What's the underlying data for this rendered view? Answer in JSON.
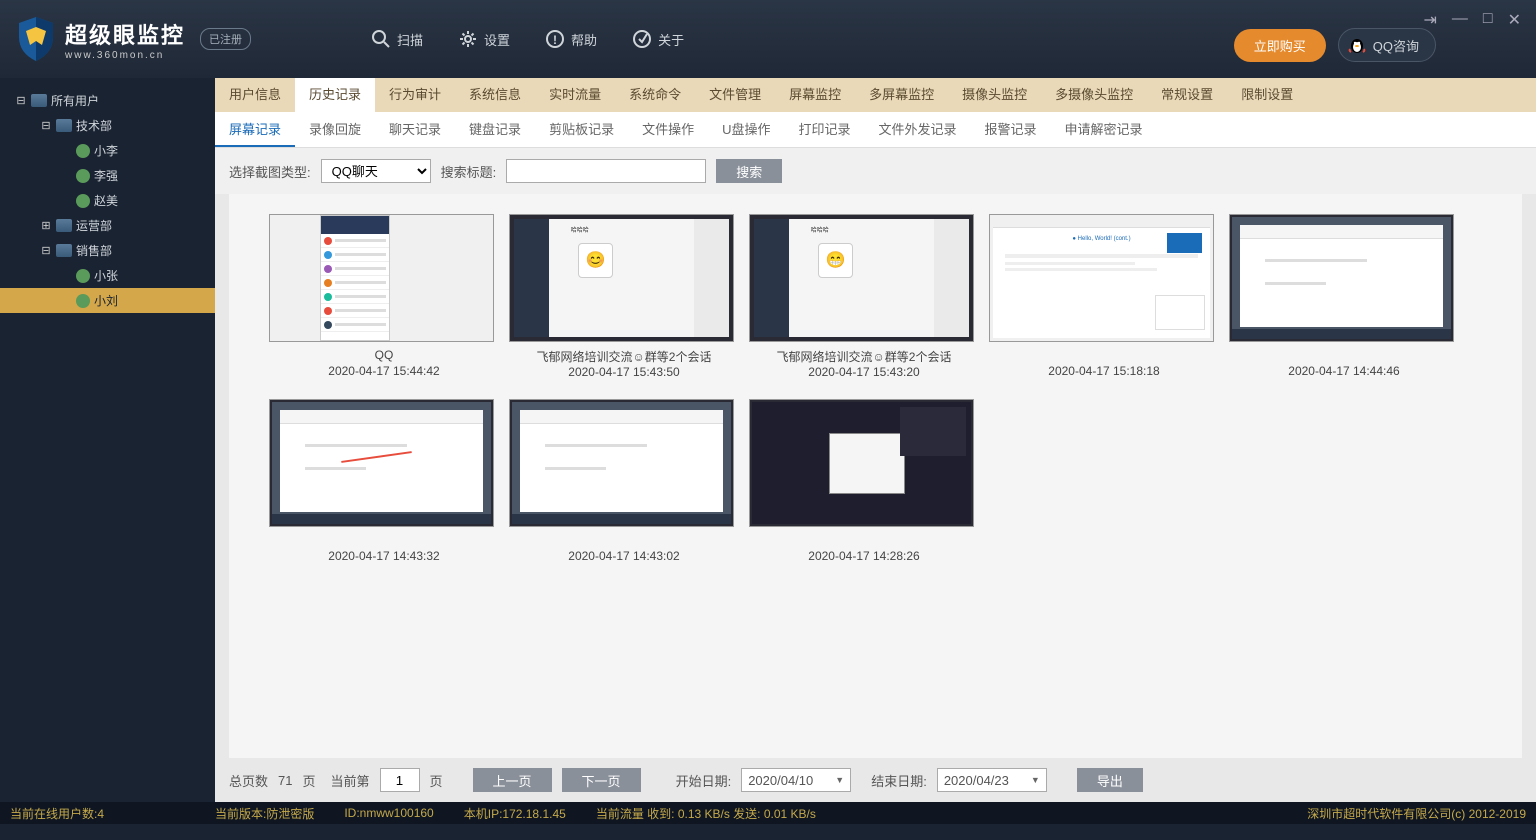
{
  "app": {
    "title_cn": "超级眼监控",
    "title_en": "www.360mon.cn",
    "registered": "已注册"
  },
  "top_actions": {
    "scan": "扫描",
    "settings": "设置",
    "help": "帮助",
    "about": "关于"
  },
  "buttons": {
    "buy_now": "立即购买",
    "qq_consult": "QQ咨询"
  },
  "tree": {
    "root": "所有用户",
    "groups": [
      {
        "name": "技术部",
        "users": [
          "小李",
          "李强",
          "赵美"
        ]
      },
      {
        "name": "运营部",
        "users": []
      },
      {
        "name": "销售部",
        "users": [
          "小张",
          "小刘"
        ]
      }
    ],
    "selected": "小刘"
  },
  "tabs_primary": [
    "用户信息",
    "历史记录",
    "行为审计",
    "系统信息",
    "实时流量",
    "系统命令",
    "文件管理",
    "屏幕监控",
    "多屏幕监控",
    "摄像头监控",
    "多摄像头监控",
    "常规设置",
    "限制设置"
  ],
  "tabs_primary_active": "历史记录",
  "tabs_secondary": [
    "屏幕记录",
    "录像回旋",
    "聊天记录",
    "键盘记录",
    "剪贴板记录",
    "文件操作",
    "U盘操作",
    "打印记录",
    "文件外发记录",
    "报警记录",
    "申请解密记录"
  ],
  "tabs_secondary_active": "屏幕记录",
  "filter": {
    "type_label": "选择截图类型:",
    "type_value": "QQ聊天",
    "title_label": "搜索标题:",
    "search_btn": "搜索"
  },
  "screenshots": [
    {
      "title": "QQ",
      "time": "2020-04-17 15:44:42",
      "style": "qq-list"
    },
    {
      "title": "飞郁网络培训交流☺群等2个会话",
      "time": "2020-04-17 15:43:50",
      "style": "qq-chat1"
    },
    {
      "title": "飞郁网络培训交流☺群等2个会话",
      "time": "2020-04-17 15:43:20",
      "style": "qq-chat2"
    },
    {
      "title": "",
      "time": "2020-04-17 15:18:18",
      "style": "browser"
    },
    {
      "title": "",
      "time": "2020-04-17 14:44:46",
      "style": "office1"
    },
    {
      "title": "",
      "time": "2020-04-17 14:43:32",
      "style": "office2"
    },
    {
      "title": "",
      "time": "2020-04-17 14:43:02",
      "style": "office3"
    },
    {
      "title": "",
      "time": "2020-04-17 14:28:26",
      "style": "ide"
    }
  ],
  "pagination": {
    "total_label": "总页数",
    "total_val": "71",
    "pages_suffix": "页",
    "current_label": "当前第",
    "current_val": "1",
    "prev": "上一页",
    "next": "下一页",
    "start_date_label": "开始日期:",
    "start_date": "2020/04/10",
    "end_date_label": "结束日期:",
    "end_date": "2020/04/23",
    "export": "导出"
  },
  "status": {
    "online": "当前在线用户数:4",
    "version": "当前版本:防泄密版",
    "id": "ID:nmww100160",
    "ip": "本机IP:172.18.1.45",
    "traffic": "当前流量 收到: 0.13 KB/s    发送: 0.01 KB/s",
    "copyright": "深圳市超时代软件有限公司(c) 2012-2019"
  }
}
